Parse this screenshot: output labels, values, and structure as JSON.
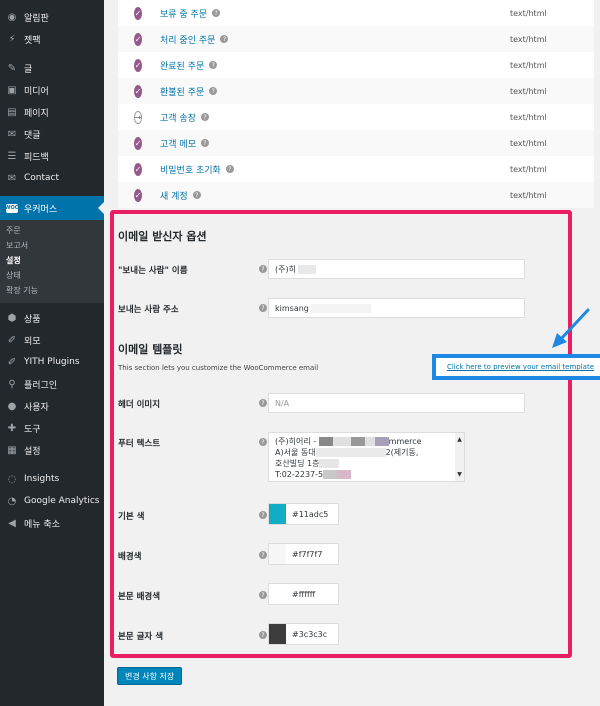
{
  "sidebar": {
    "items_top": [
      {
        "label": "알림판",
        "icon": "dashboard-icon",
        "glyph": "◉"
      },
      {
        "label": "젯팩",
        "icon": "jetpack-icon",
        "glyph": "⚡"
      }
    ],
    "items_mid": [
      {
        "label": "글",
        "icon": "pin-icon",
        "glyph": "✎"
      },
      {
        "label": "미디어",
        "icon": "media-icon",
        "glyph": "▣"
      },
      {
        "label": "페이지",
        "icon": "page-icon",
        "glyph": "▤"
      },
      {
        "label": "댓글",
        "icon": "comment-icon",
        "glyph": "✉"
      },
      {
        "label": "피드백",
        "icon": "feedback-icon",
        "glyph": "☰"
      },
      {
        "label": "Contact",
        "icon": "mail-icon",
        "glyph": "✉"
      }
    ],
    "active": {
      "label": "우커머스",
      "logo_text": "WOO"
    },
    "submenu": [
      "주문",
      "보고서",
      "설정",
      "상태",
      "확장 기능"
    ],
    "submenu_current": "설정",
    "items_bottom": [
      {
        "label": "상품",
        "icon": "product-icon",
        "glyph": "⬢"
      },
      {
        "label": "외모",
        "icon": "appearance-icon",
        "glyph": "✐"
      },
      {
        "label": "YITH Plugins",
        "icon": "yith-icon",
        "glyph": "✐"
      },
      {
        "label": "플러그인",
        "icon": "plugin-icon",
        "glyph": "⚲"
      },
      {
        "label": "사용자",
        "icon": "user-icon",
        "glyph": "●"
      },
      {
        "label": "도구",
        "icon": "tool-icon",
        "glyph": "✚"
      },
      {
        "label": "설정",
        "icon": "settings-icon",
        "glyph": "▦"
      }
    ],
    "items_extra": [
      {
        "label": "Insights",
        "icon": "insights-icon",
        "glyph": "◌"
      },
      {
        "label": "Google Analytics",
        "icon": "analytics-icon",
        "glyph": "◔"
      },
      {
        "label": "메뉴 축소",
        "icon": "collapse-icon",
        "glyph": "◀"
      }
    ]
  },
  "emails": [
    {
      "name": "보류 중 주문",
      "type": "text/html",
      "enabled": true
    },
    {
      "name": "처리 중인 주문",
      "type": "text/html",
      "enabled": true
    },
    {
      "name": "완료된 주문",
      "type": "text/html",
      "enabled": true
    },
    {
      "name": "환불된 주문",
      "type": "text/html",
      "enabled": true
    },
    {
      "name": "고객 송장",
      "type": "text/html",
      "enabled": false
    },
    {
      "name": "고객 메모",
      "type": "text/html",
      "enabled": true
    },
    {
      "name": "비밀번호 초기화",
      "type": "text/html",
      "enabled": true
    },
    {
      "name": "새 계정",
      "type": "text/html",
      "enabled": true
    }
  ],
  "sender": {
    "section_title": "이메일 받신자 옵션",
    "from_name_label": "\"보내는 사람\" 이름",
    "from_name_value": "(주)히",
    "from_address_label": "보내는 사람 주소",
    "from_address_value": "kimsang"
  },
  "template": {
    "section_title": "이메일 템플릿",
    "description": "This section lets you customize the WooCommerce email",
    "preview_link": "Click here to preview your email template",
    "header_image_label": "헤더 이미지",
    "header_image_placeholder": "N/A",
    "footer_label": "푸터 텍스트",
    "footer_lines": [
      "(주)히어리 - ",
      "mmerce",
      "A)서울 동대",
      "2(제기동,",
      "호산빌딩 1층",
      "T:02-2237-5"
    ],
    "base_color_label": "기본 색",
    "base_color": "#11adc5",
    "bg_color_label": "배경색",
    "bg_color": "#f7f7f7",
    "body_bg_label": "본문 배경색",
    "body_bg_color": "#ffffff",
    "body_text_label": "본문 글자 색",
    "body_text_color": "#3c3c3c"
  },
  "save_label": "변경 사항 저장",
  "colors": {
    "accent_highlight": "#e91e63",
    "preview_highlight": "#1e88e5",
    "woo_purple": "#96588a",
    "wp_blue": "#0073aa"
  }
}
